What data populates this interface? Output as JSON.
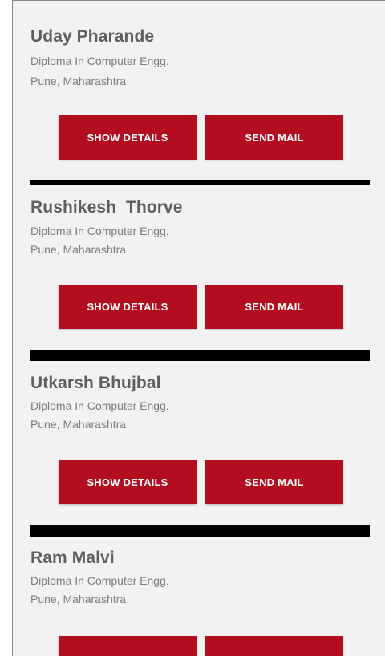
{
  "students": [
    {
      "name": "Uday Pharande",
      "course": "Diploma In Computer Engg.",
      "location": "Pune, Maharashtra",
      "details_label": "SHOW DETAILS",
      "mail_label": "SEND MAIL"
    },
    {
      "name": "Rushikesh  Thorve",
      "course": "Diploma In Computer Engg.",
      "location": "Pune, Maharashtra",
      "details_label": "SHOW DETAILS",
      "mail_label": "SEND MAIL"
    },
    {
      "name": "Utkarsh Bhujbal",
      "course": "Diploma In Computer Engg.",
      "location": "Pune, Maharashtra",
      "details_label": "SHOW DETAILS",
      "mail_label": "SEND MAIL"
    },
    {
      "name": "Ram Malvi",
      "course": "Diploma In Computer Engg.",
      "location": "Pune, Maharashtra",
      "details_label": "",
      "mail_label": ""
    }
  ],
  "colors": {
    "button": "#b20e1f",
    "divider": "#000000",
    "background": "#f2f2f2"
  }
}
